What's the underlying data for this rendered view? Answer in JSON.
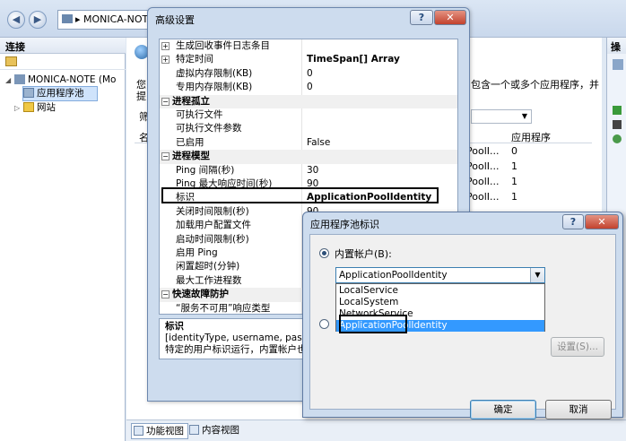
{
  "main": {
    "address": "MONICA-NOTE",
    "left_pane_title": "连接",
    "tree": [
      {
        "label": "MONICA-NOTE (Mo",
        "level": 0
      },
      {
        "label": "应用程序池",
        "level": 1,
        "selected": true
      },
      {
        "label": "网站",
        "level": 1
      }
    ],
    "center_fragments": {
      "intro_left": "您",
      "intro_left2": "提",
      "intro_right": "包含一个或多个应用程序，并",
      "column_letter": "名",
      "column_apps": "应用程序",
      "filter_letter": "筛",
      "rows": [
        {
          "mid": "PoolI...",
          "apps": "0"
        },
        {
          "mid": "PoolI...",
          "apps": "1"
        },
        {
          "mid": "PoolI...",
          "apps": "1"
        },
        {
          "mid": "PoolI...",
          "apps": "1"
        }
      ]
    },
    "right_pane_title": "操",
    "view_tabs": [
      "功能视图",
      "内容视图"
    ]
  },
  "advanced_dialog": {
    "title": "高级设置",
    "help": "?",
    "close": "✕",
    "properties": [
      {
        "type": "row",
        "name": "生成回收事件日志条目",
        "value": "",
        "expander": "+"
      },
      {
        "type": "row",
        "name": "特定时间",
        "value": "TimeSpan[] Array",
        "expander": "+",
        "bold": true
      },
      {
        "type": "row",
        "name": "虚拟内存限制(KB)",
        "value": "0"
      },
      {
        "type": "row",
        "name": "专用内存限制(KB)",
        "value": "0"
      },
      {
        "type": "cat",
        "name": "进程孤立",
        "expander": "−"
      },
      {
        "type": "row",
        "name": "可执行文件",
        "value": ""
      },
      {
        "type": "row",
        "name": "可执行文件参数",
        "value": ""
      },
      {
        "type": "row",
        "name": "已启用",
        "value": "False"
      },
      {
        "type": "cat",
        "name": "进程模型",
        "expander": "−"
      },
      {
        "type": "row",
        "name": "Ping 间隔(秒)",
        "value": "30"
      },
      {
        "type": "row",
        "name": "Ping 最大响应时间(秒)",
        "value": "90"
      },
      {
        "type": "row",
        "name": "标识",
        "value": "ApplicationPoolIdentity",
        "bold": true
      },
      {
        "type": "row",
        "name": "关闭时间限制(秒)",
        "value": "90"
      },
      {
        "type": "row",
        "name": "加载用户配置文件",
        "value": ""
      },
      {
        "type": "row",
        "name": "启动时间限制(秒)",
        "value": ""
      },
      {
        "type": "row",
        "name": "启用 Ping",
        "value": ""
      },
      {
        "type": "row",
        "name": "闲置超时(分钟)",
        "value": ""
      },
      {
        "type": "row",
        "name": "最大工作进程数",
        "value": ""
      },
      {
        "type": "cat",
        "name": "快速故障防护",
        "expander": "−"
      },
      {
        "type": "row",
        "name": "“服务不可用”响应类型",
        "value": ""
      }
    ],
    "description": {
      "title": "标识",
      "line1": "[identityType, username, passwo",
      "line2": "特定的用户标识运行，内置帐户也就"
    }
  },
  "identity_dialog": {
    "title": "应用程序池标识",
    "help": "?",
    "close": "✕",
    "builtin_label": "内置帐户(B):",
    "combo_value": "ApplicationPoolIdentity",
    "options": [
      "LocalService",
      "LocalSystem",
      "NetworkService",
      "ApplicationPoolIdentity"
    ],
    "selected_option": "ApplicationPoolIdentity",
    "set_button": "设置(S)...",
    "ok_button": "确定",
    "cancel_button": "取消"
  }
}
